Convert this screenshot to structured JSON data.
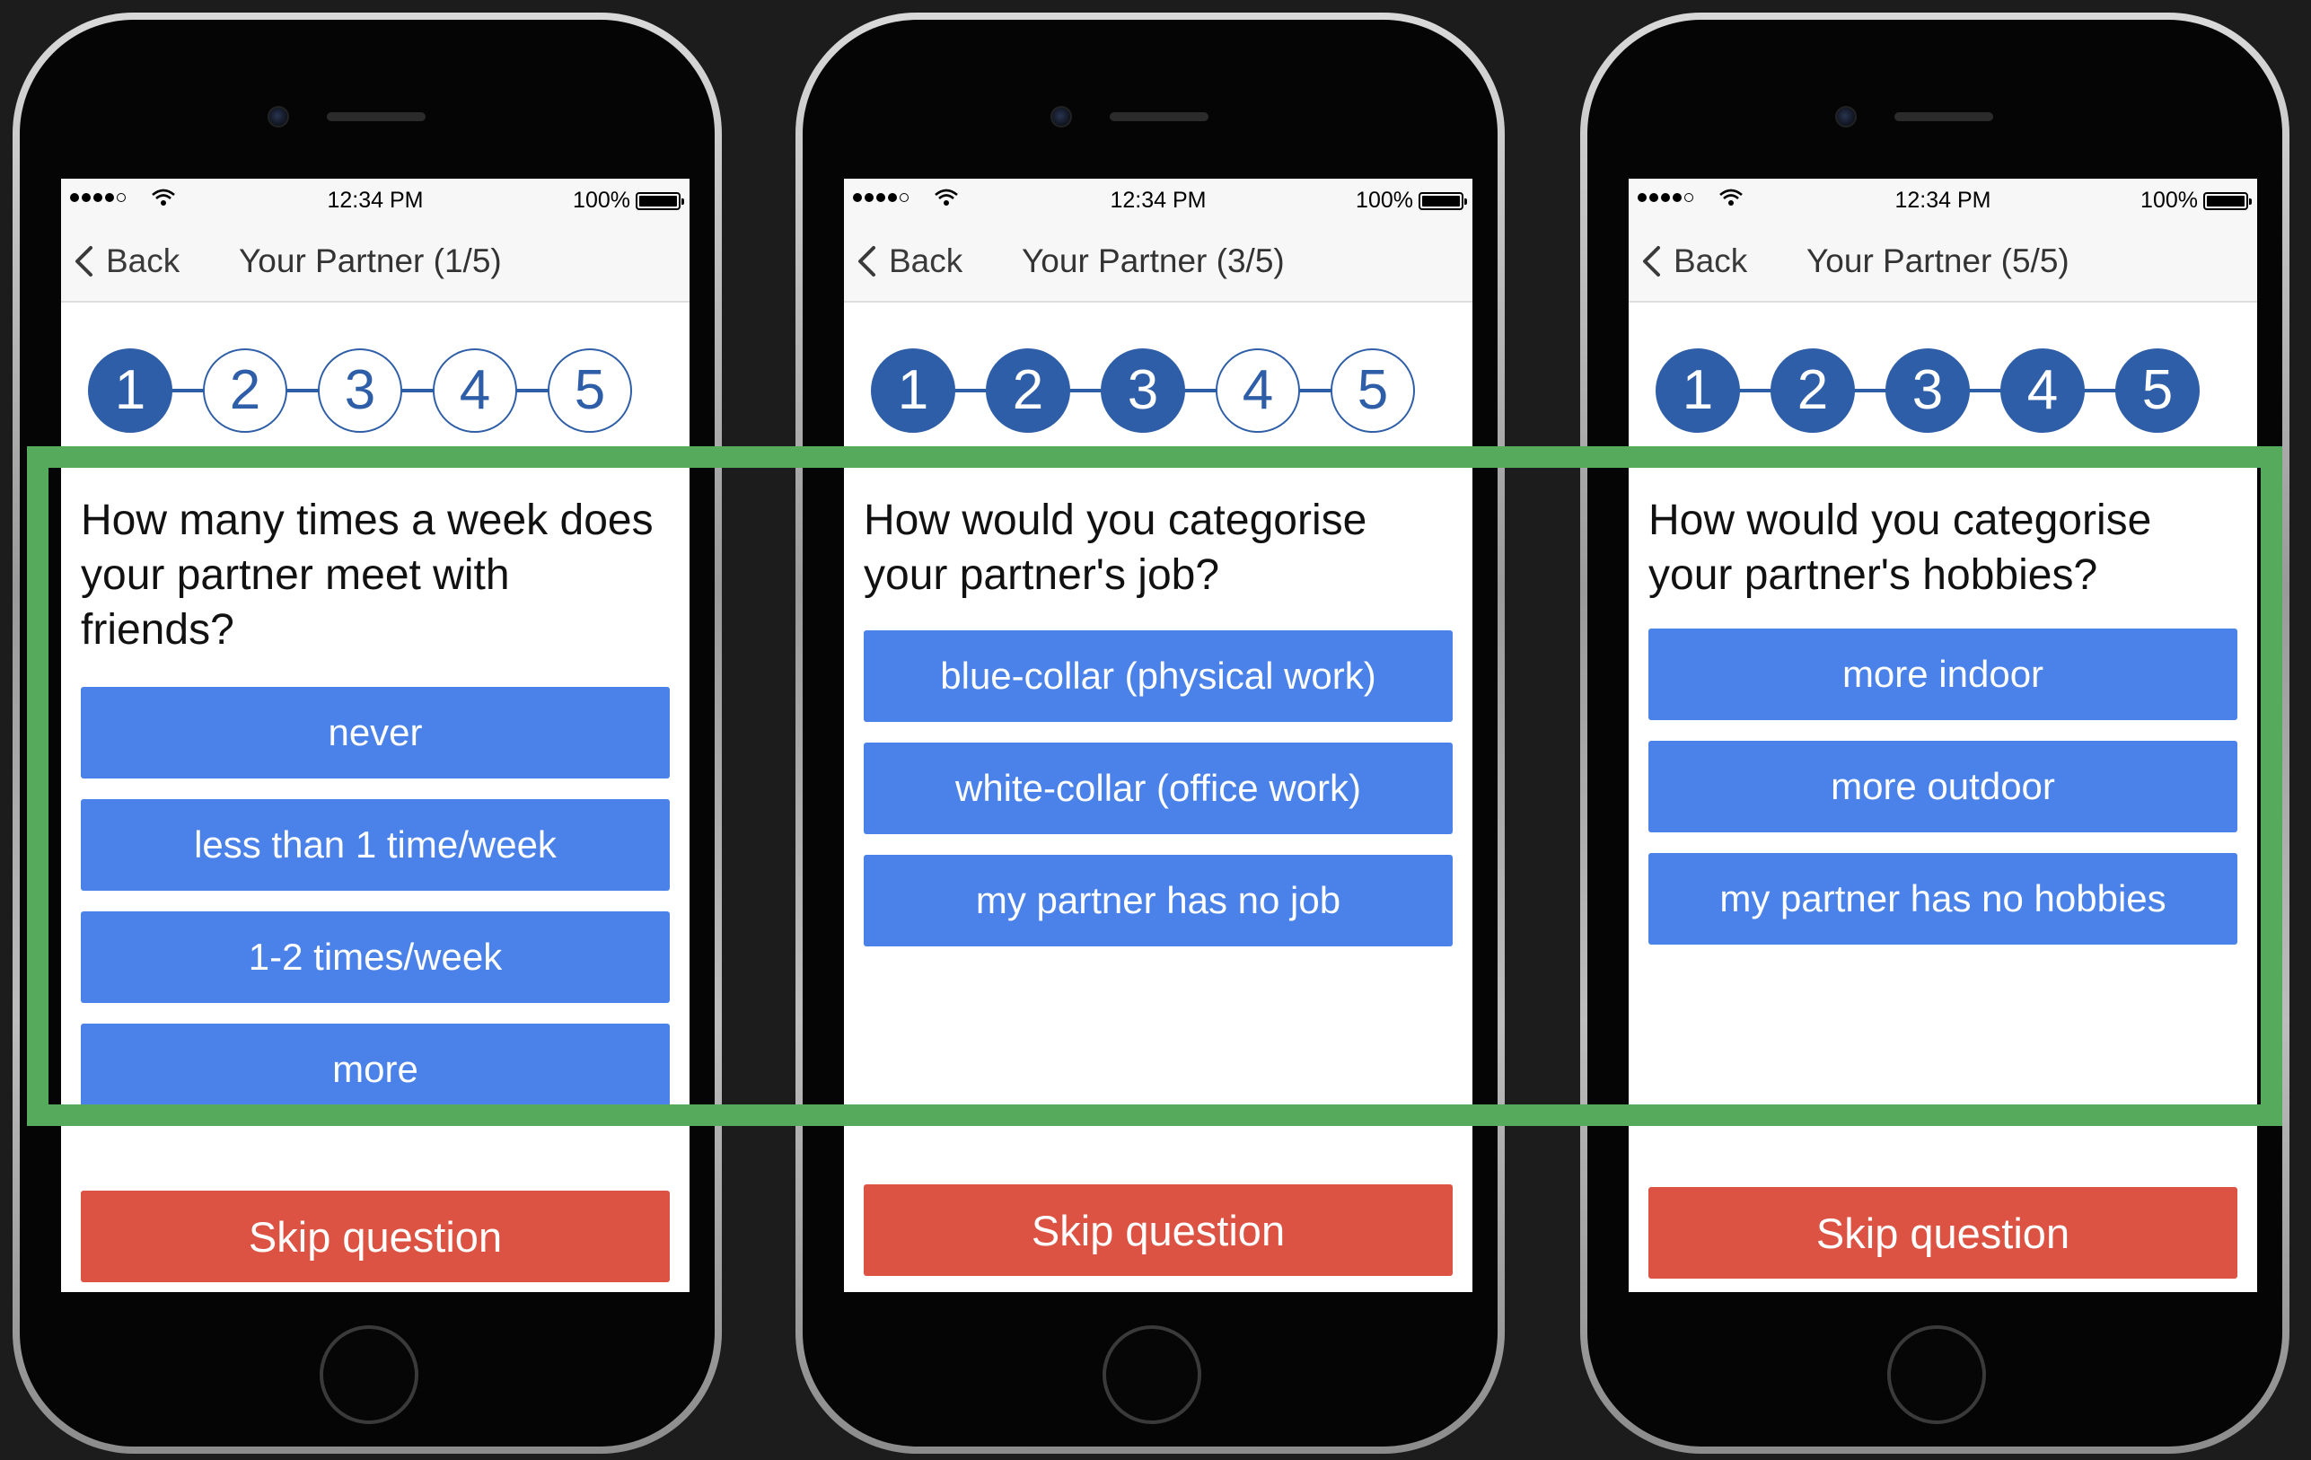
{
  "status_bar": {
    "time": "12:34 PM",
    "battery": "100%"
  },
  "nav": {
    "back_label": "Back"
  },
  "accent_colors": {
    "step_blue": "#2f5ea8",
    "answer_blue": "#4a82ea",
    "skip_red": "#dd5343",
    "highlight_green": "#55ab5b"
  },
  "phones": [
    {
      "title": "Your Partner (1/5)",
      "steps": [
        {
          "label": "1",
          "done": true
        },
        {
          "label": "2",
          "done": false
        },
        {
          "label": "3",
          "done": false
        },
        {
          "label": "4",
          "done": false
        },
        {
          "label": "5",
          "done": false
        }
      ],
      "question": "How many times a week does your partner meet with friends?",
      "answers": [
        "never",
        "less than 1 time/week",
        "1-2 times/week",
        "more"
      ],
      "skip_label": "Skip question"
    },
    {
      "title": "Your Partner (3/5)",
      "steps": [
        {
          "label": "1",
          "done": true
        },
        {
          "label": "2",
          "done": true
        },
        {
          "label": "3",
          "done": true
        },
        {
          "label": "4",
          "done": false
        },
        {
          "label": "5",
          "done": false
        }
      ],
      "question": "How would you categorise your partner's job?",
      "answers": [
        "blue-collar (physical work)",
        "white-collar (office work)",
        "my partner has no job"
      ],
      "skip_label": "Skip question"
    },
    {
      "title": "Your Partner (5/5)",
      "steps": [
        {
          "label": "1",
          "done": true
        },
        {
          "label": "2",
          "done": true
        },
        {
          "label": "3",
          "done": true
        },
        {
          "label": "4",
          "done": true
        },
        {
          "label": "5",
          "done": true
        }
      ],
      "question": "How would you categorise your partner's hobbies?",
      "answers": [
        "more indoor",
        "more outdoor",
        "my partner has no hobbies"
      ],
      "skip_label": "Skip question"
    }
  ]
}
